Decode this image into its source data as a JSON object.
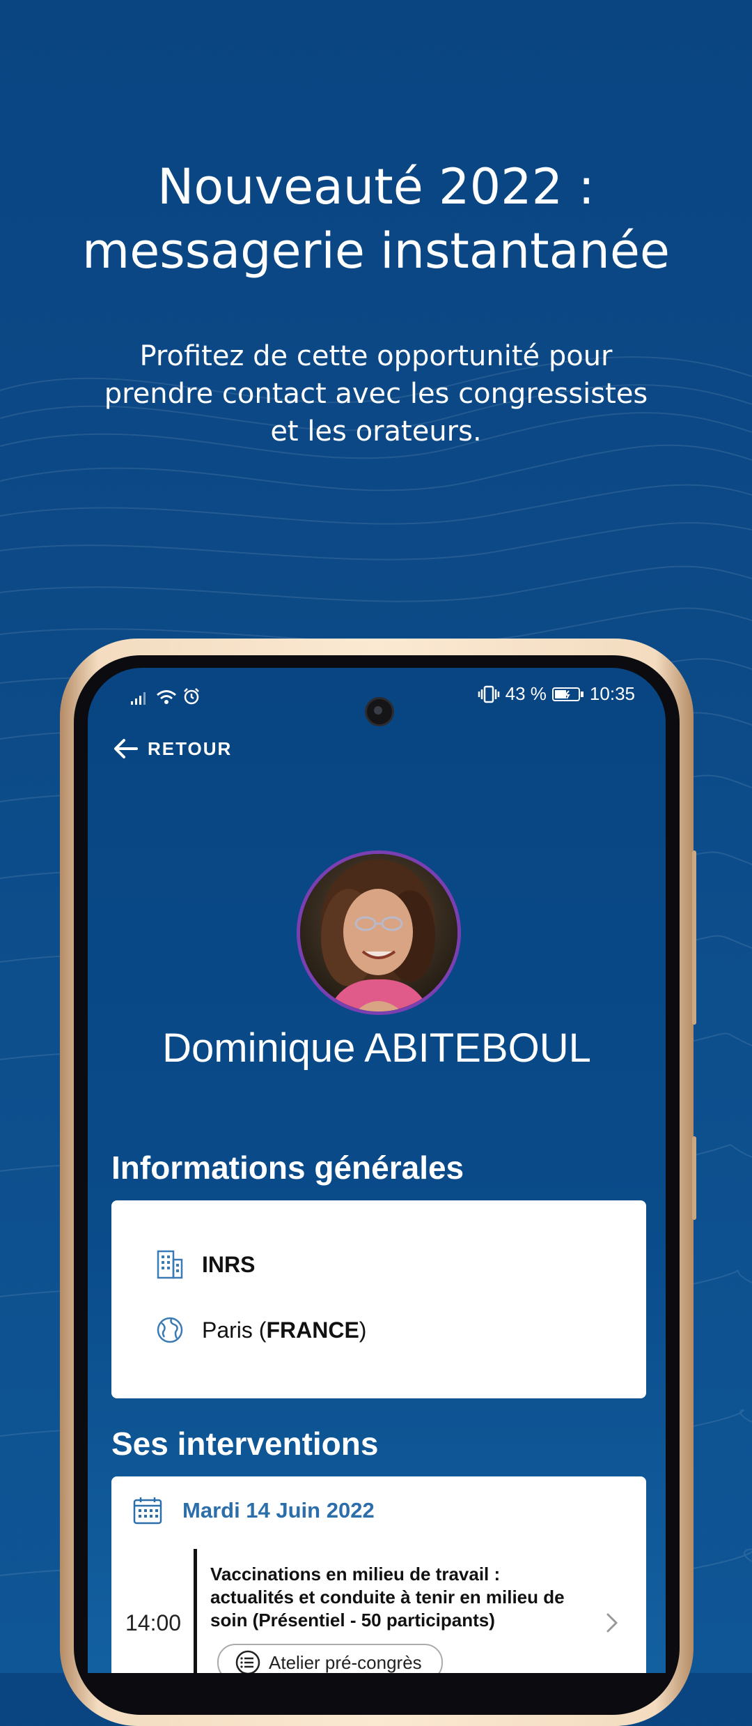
{
  "promo": {
    "headline_line1": "Nouveauté 2022 :",
    "headline_line2": "messagerie instantanée",
    "subline_line1": "Profitez de cette opportunité pour",
    "subline_line2": "prendre contact avec les congressistes",
    "subline_line3": "et les orateurs."
  },
  "status_bar": {
    "battery": "43 %",
    "time": "10:35"
  },
  "nav": {
    "back_label": "RETOUR"
  },
  "profile": {
    "name": "Dominique ABITEBOUL"
  },
  "general_info": {
    "title": "Informations générales",
    "organization": "INRS",
    "city": "Paris",
    "country": "FRANCE"
  },
  "interventions": {
    "title": "Ses interventions",
    "date": "Mardi 14 Juin 2022",
    "time": "14:00",
    "session_line1": "Vaccinations en milieu de travail :",
    "session_line2": "actualités et conduite à tenir en milieu de",
    "session_line3": "soin (Présentiel - 50 participants)",
    "session_type": "Atelier pré-congrès"
  },
  "colors": {
    "background": "#0a4582",
    "accent_date": "#2b6eaa",
    "avatar_ring": "#7a3fb0"
  },
  "icons": [
    "back-arrow-icon",
    "signal-icon",
    "wifi-icon",
    "alarm-icon",
    "vibrate-icon",
    "battery-icon",
    "building-icon",
    "globe-icon",
    "calendar-icon",
    "chevron-right-icon",
    "list-icon"
  ]
}
